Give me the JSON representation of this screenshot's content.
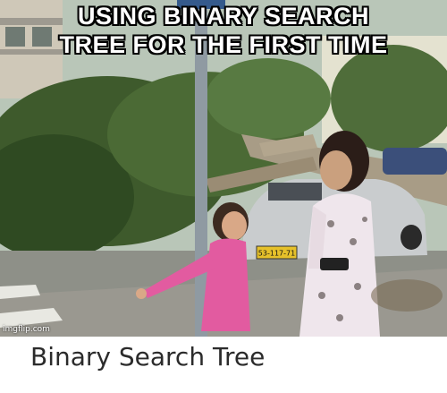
{
  "meme": {
    "caption_line1": "USING BINARY SEARCH",
    "caption_line2": "TREE FOR THE FIRST TIME",
    "watermark": "imgflip.com",
    "license_plate": "53-117-71"
  },
  "caption_below": "Binary Search Tree"
}
